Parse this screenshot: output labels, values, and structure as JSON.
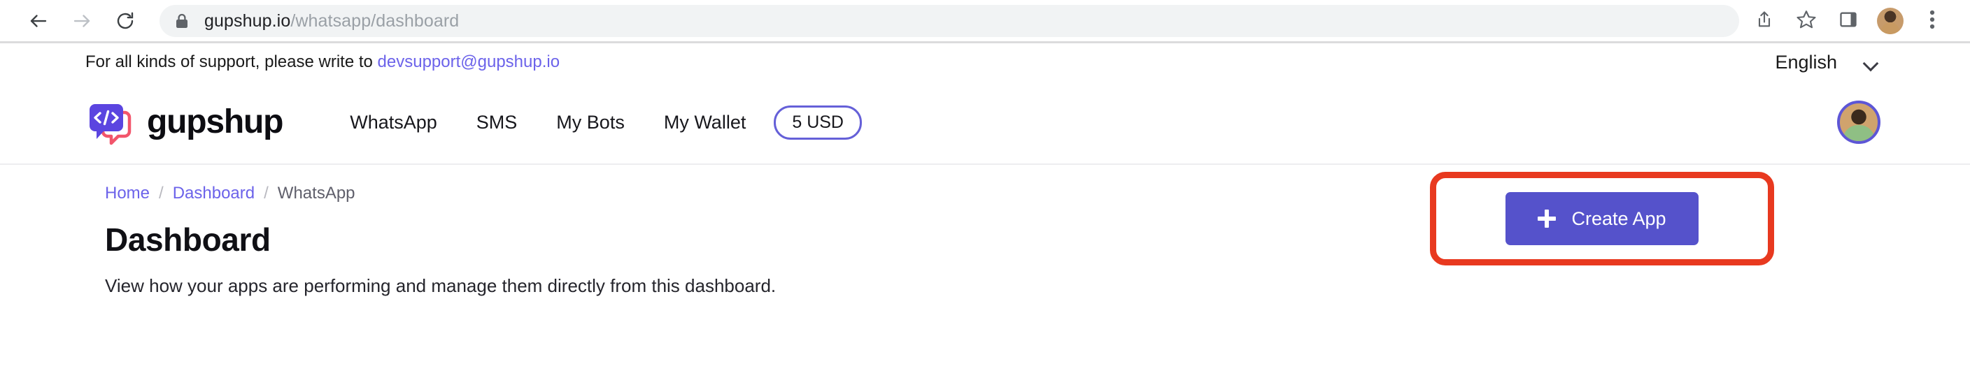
{
  "browser": {
    "back_icon": "back-arrow-icon",
    "forward_icon": "forward-arrow-icon",
    "reload_icon": "reload-icon",
    "lock_icon": "lock-icon",
    "url_domain": "gupshup.io",
    "url_path": "/whatsapp/dashboard",
    "share_icon": "share-icon",
    "bookmark_icon": "star-bookmark-icon",
    "sidepanel_icon": "side-panel-icon",
    "profile_icon": "browser-profile-avatar",
    "menu_icon": "three-dot-menu-icon"
  },
  "support": {
    "text_before": "For all kinds of support, please write to ",
    "email": "devsupport@gupshup.io"
  },
  "language": {
    "selected": "English",
    "chevron_icon": "chevron-down-icon"
  },
  "header": {
    "logo_text": "gupshup",
    "logo_icon": "code-chat-bubble-icon",
    "nav_items": [
      {
        "label": "WhatsApp"
      },
      {
        "label": "SMS"
      },
      {
        "label": "My Bots"
      },
      {
        "label": "My Wallet"
      }
    ],
    "wallet_badge": "5 USD",
    "avatar_icon": "user-avatar"
  },
  "breadcrumb": {
    "items": [
      {
        "label": "Home",
        "link": true
      },
      {
        "label": "Dashboard",
        "link": true
      },
      {
        "label": "WhatsApp",
        "link": false
      }
    ],
    "separator": "/"
  },
  "main": {
    "title": "Dashboard",
    "subtitle": "View how your apps are performing and manage them directly from this dashboard.",
    "create_app_label": "Create App",
    "create_app_icon": "plus-icon"
  },
  "colors": {
    "brand_purple": "#5552cb",
    "link_purple": "#6c63ea",
    "highlight_red": "#e8391f",
    "logo_purple": "#5b45e0",
    "logo_pink": "#f2556b"
  }
}
